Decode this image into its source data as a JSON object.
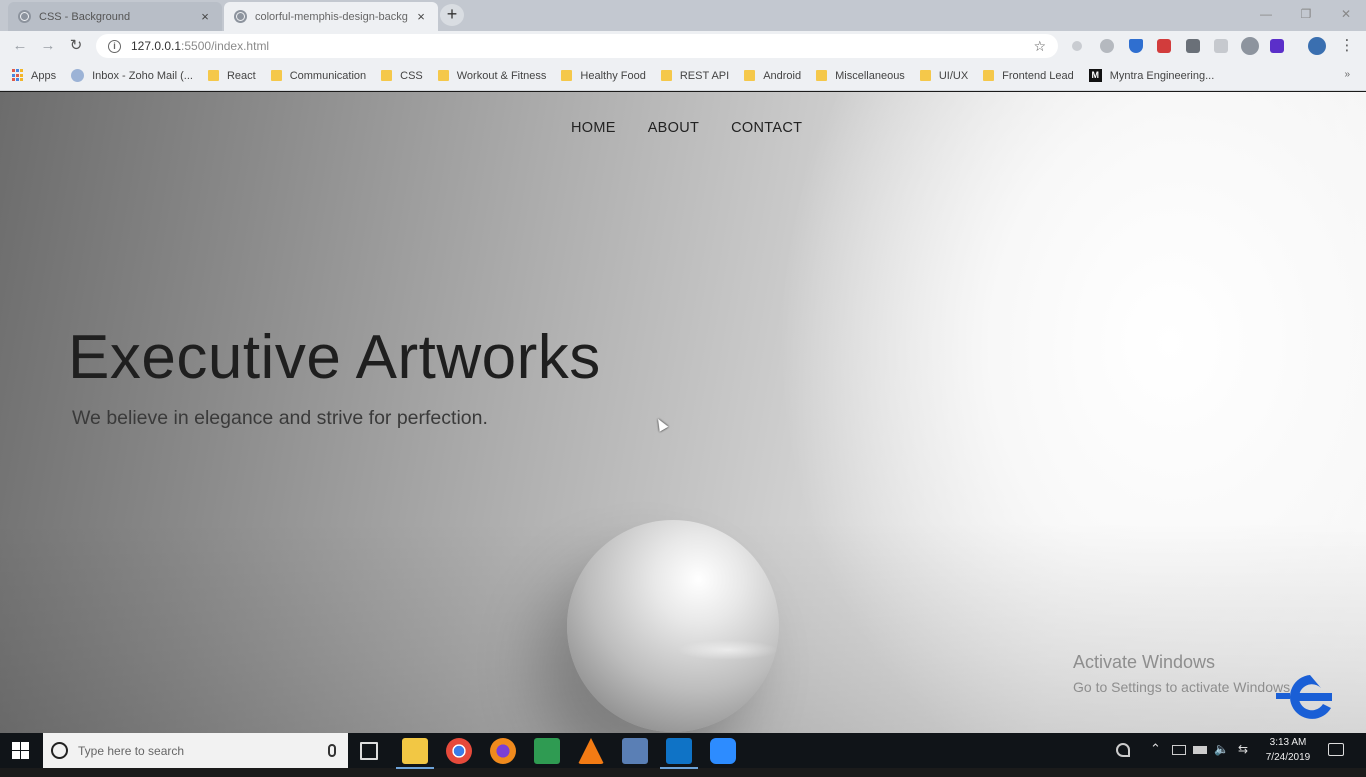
{
  "browser": {
    "tabs": [
      {
        "title": "CSS - Background",
        "active": false
      },
      {
        "title": "colorful-memphis-design-backg",
        "active": true
      }
    ],
    "new_tab_label": "+",
    "close_label": "×",
    "address": {
      "host": "127.0.0.1",
      "path": ":5500/index.html"
    },
    "window_controls": {
      "minimize": "—",
      "maximize": "❐",
      "close": "✕"
    }
  },
  "bookmarks": [
    {
      "label": "Apps",
      "icon": "apps-grid-icon"
    },
    {
      "label": "Inbox - Zoho Mail (...",
      "icon": "zoho-icon"
    },
    {
      "label": "React",
      "icon": "folder-icon"
    },
    {
      "label": "Communication",
      "icon": "folder-icon"
    },
    {
      "label": "CSS",
      "icon": "folder-icon"
    },
    {
      "label": "Workout & Fitness",
      "icon": "folder-icon"
    },
    {
      "label": "Healthy Food",
      "icon": "folder-icon"
    },
    {
      "label": "REST API",
      "icon": "folder-icon"
    },
    {
      "label": "Android",
      "icon": "folder-icon"
    },
    {
      "label": "Miscellaneous",
      "icon": "folder-icon"
    },
    {
      "label": "UI/UX",
      "icon": "folder-icon"
    },
    {
      "label": "Frontend Lead",
      "icon": "folder-icon"
    },
    {
      "label": "Myntra Engineering...",
      "icon": "medium-icon"
    }
  ],
  "site": {
    "nav": [
      "HOME",
      "ABOUT",
      "CONTACT"
    ],
    "hero_title": "Executive Artworks",
    "hero_subtitle": "We believe in elegance and strive for perfection."
  },
  "watermark": {
    "line1": "Activate Windows",
    "line2": "Go to Settings to activate Windows."
  },
  "taskbar": {
    "search_placeholder": "Type here to search",
    "time": "3:13 AM",
    "date": "7/24/2019"
  },
  "colors": {
    "chrome_tabstrip": "#c3c8d0",
    "chrome_toolbar": "#eef0f3",
    "taskbar": "#101418",
    "edureka_blue": "#1a5fd6"
  }
}
